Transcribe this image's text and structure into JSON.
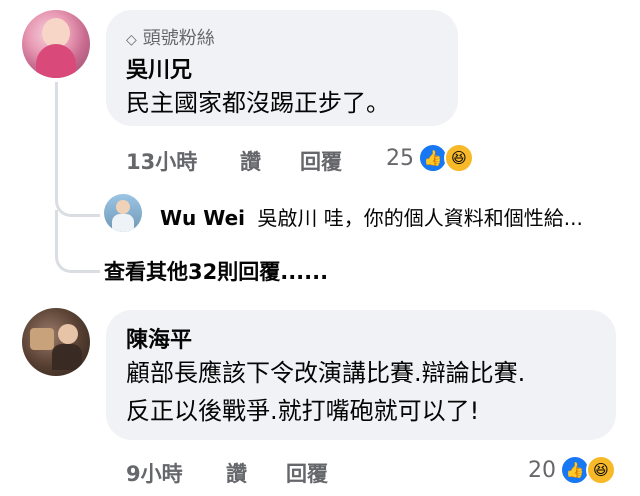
{
  "comments": [
    {
      "badge": "頭號粉絲",
      "author": "吳川兄",
      "text": "民主國家都沒踢正步了。",
      "time": "13小時",
      "like": "讚",
      "reply": "回覆",
      "reactions_count": "25",
      "reaction_icons": [
        "like-icon",
        "haha-icon"
      ]
    },
    {
      "author": "陳海平",
      "lines": [
        "顧部長應該下令改演講比賽.辯論比賽.",
        "反正以後戰爭.就打嘴砲就可以了!"
      ],
      "time": "9小時",
      "like": "讚",
      "reply": "回覆",
      "reactions_count": "20",
      "reaction_icons": [
        "like-icon",
        "haha-icon"
      ]
    }
  ],
  "reply_preview": {
    "author": "Wu Wei",
    "text": "吳啟川 哇，你的個人資料和個性給..."
  },
  "more_replies": "查看其他32則回覆......",
  "colors": {
    "like_blue": "#1877f2",
    "haha_yellow": "#f7b928",
    "bubble": "#f0f2f5",
    "meta_gray": "#65676b"
  }
}
